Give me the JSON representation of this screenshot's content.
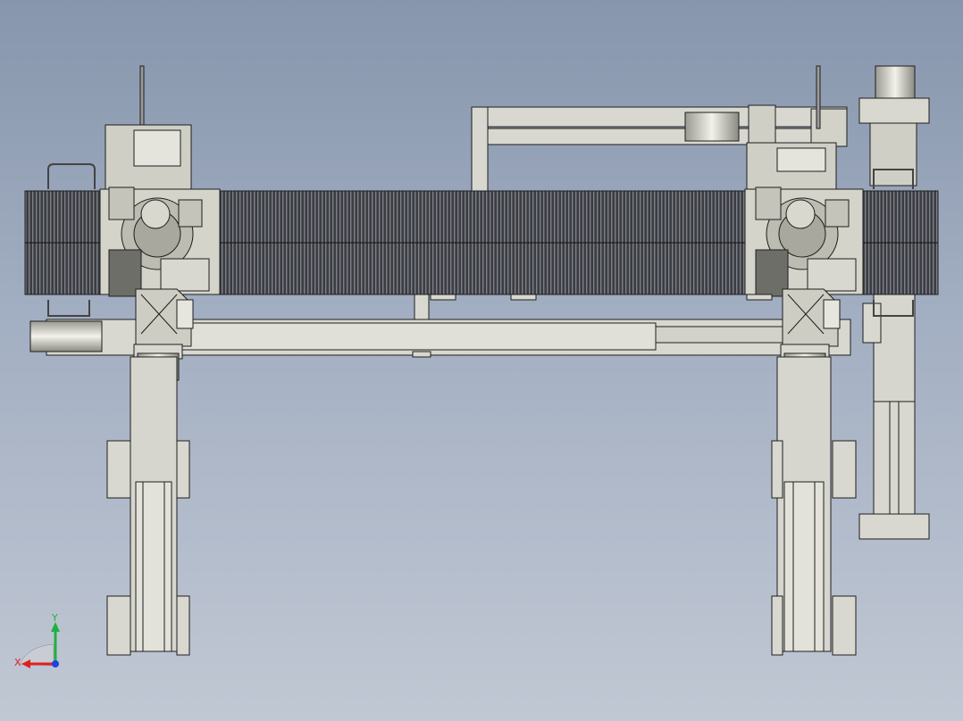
{
  "viewport": {
    "background_top": "#8796ad",
    "background_bottom": "#c1c8d4"
  },
  "model": {
    "part_color_light": "#dcdcd4",
    "part_color_mid": "#c9c9bf",
    "edge_color": "#1e1e1e",
    "bellows_color": "#3a3c40",
    "description_icon": "gantry-robot-assembly-icon"
  },
  "triad": {
    "x_label": "X",
    "y_label": "Y",
    "x_color": "#e02020",
    "y_color": "#20b040",
    "z_color": "#2040e0"
  }
}
